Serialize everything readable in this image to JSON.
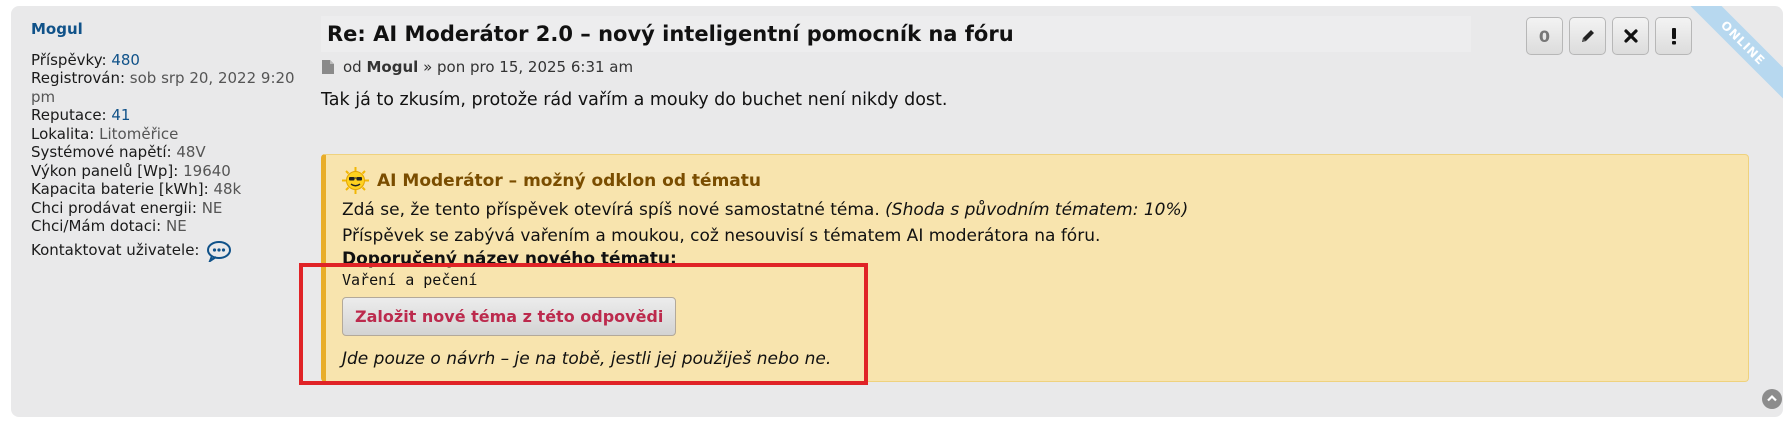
{
  "profile": {
    "username": "Mogul",
    "posts_label": "Příspěvky:",
    "posts_value": "480",
    "registered_label": "Registrován:",
    "registered_value": "sob srp 20, 2022 9:20 pm",
    "reputation_label": "Reputace:",
    "reputation_value": "41",
    "location_label": "Lokalita:",
    "location_value": "Litoměřice",
    "voltage_label": "Systémové napětí:",
    "voltage_value": "48V",
    "panel_label": "Výkon panelů [Wp]:",
    "panel_value": "19640",
    "battery_label": "Kapacita baterie [kWh]:",
    "battery_value": "48k",
    "sell_label": "Chci prodávat energii:",
    "sell_value": "NE",
    "subsidy_label": "Chci/Mám dotaci:",
    "subsidy_value": "NE",
    "contact_label": "Kontaktovat uživatele:",
    "contact_icon": "chat-bubble-icon"
  },
  "post": {
    "title": "Re: AI Moderátor 2.0 – nový inteligentní pomocník na fóru",
    "meta_prefix": "od",
    "meta_author": "Mogul",
    "meta_date": "» pon pro 15, 2025 6:31 am",
    "content": "Tak já to zkusím, protože rád vařím a mouky do buchet není nikdy dost."
  },
  "actions": {
    "count": "0",
    "edit_icon": "pencil-icon",
    "delete_icon": "close-icon",
    "report_icon": "exclamation-icon"
  },
  "status_ribbon": "ONLINE",
  "ai_box": {
    "heading": "AI Moderátor – možný odklon od tématu",
    "line1": "Zdá se, že tento příspěvek otevírá spíš nové samostatné téma.",
    "line1_italic": "(Shoda s původním tématem: 10%)",
    "line2": "Příspěvek se zabývá vařením a moukou, což nesouvisí s tématem AI moderátora na fóru.",
    "suggest_label": "Doporučený název nového tématu:",
    "suggest_value": "Vaření a pečení",
    "button_label": "Založit nové téma z této odpovědi",
    "note": "Jde pouze o návrh – je na tobě, jestli jej použiješ nebo ne."
  },
  "colors": {
    "link": "#105289",
    "ai_box_bg": "#f8e4ae",
    "ai_box_accent": "#e8ad2a",
    "button_text": "#bc2a4d",
    "highlight": "#e02327"
  }
}
